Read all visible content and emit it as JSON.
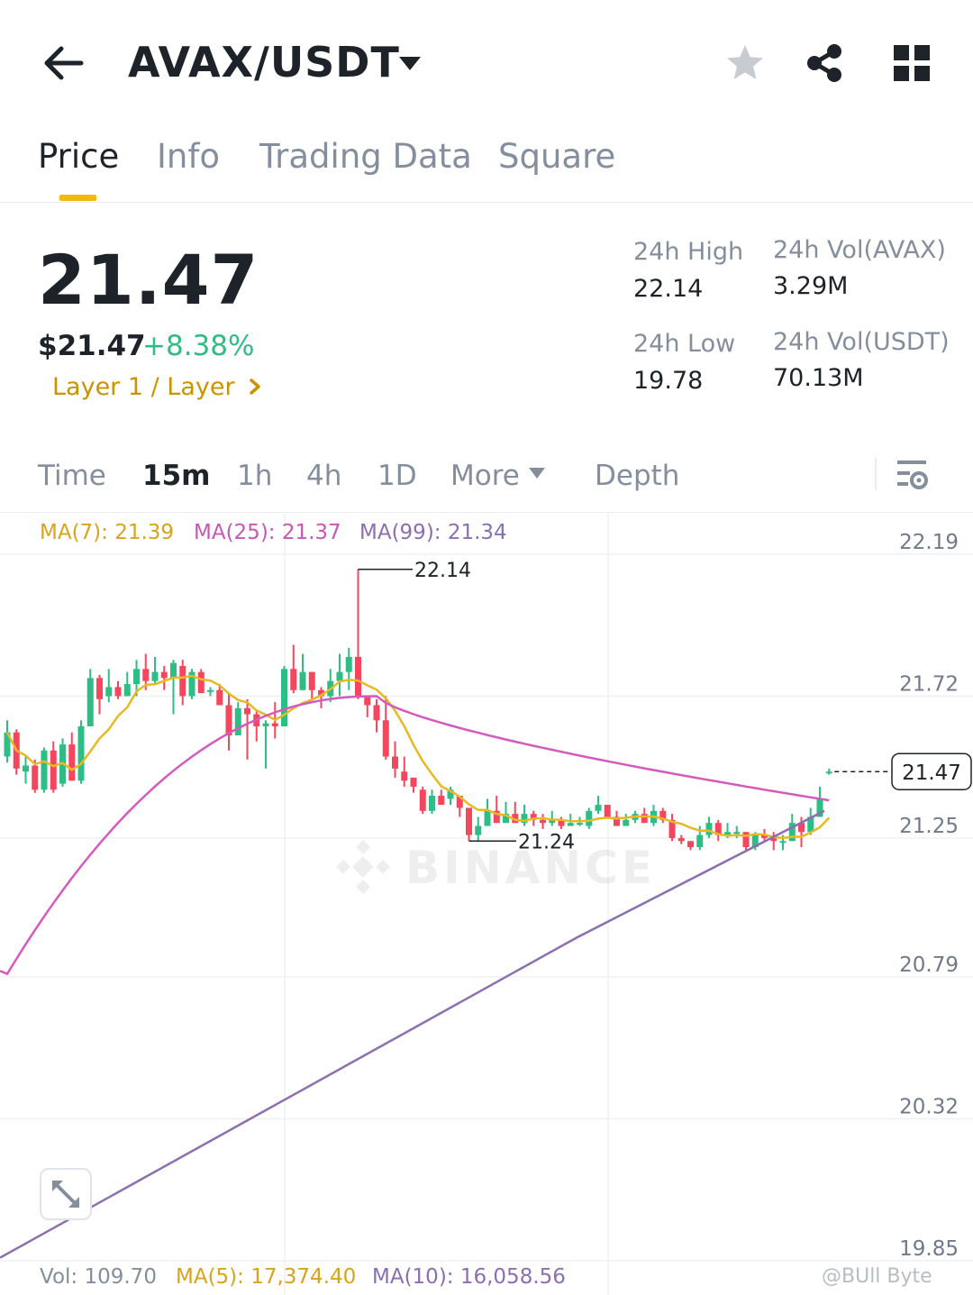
{
  "header": {
    "pair": "AVAX/USDT",
    "icons": [
      "back-arrow-icon",
      "caret-down-icon",
      "star-icon",
      "share-icon",
      "grid-icon"
    ]
  },
  "tabs": [
    {
      "label": "Price",
      "active": true
    },
    {
      "label": "Info",
      "active": false
    },
    {
      "label": "Trading Data",
      "active": false
    },
    {
      "label": "Square",
      "active": false
    }
  ],
  "ticker": {
    "price": "21.47",
    "usd_price": "$21.47",
    "change": "+8.38%",
    "category": "Layer 1 / Layer",
    "stats": [
      {
        "label": "24h High",
        "value": "22.14"
      },
      {
        "label": "24h Vol(AVAX)",
        "value": "3.29M"
      },
      {
        "label": "24h Low",
        "value": "19.78"
      },
      {
        "label": "24h Vol(USDT)",
        "value": "70.13M"
      }
    ]
  },
  "intervals": [
    {
      "label": "Time",
      "active": false
    },
    {
      "label": "15m",
      "active": true
    },
    {
      "label": "1h",
      "active": false
    },
    {
      "label": "4h",
      "active": false
    },
    {
      "label": "1D",
      "active": false
    },
    {
      "label": "More",
      "active": false
    },
    {
      "label": "Depth",
      "active": false
    }
  ],
  "ma_legend": [
    {
      "label": "MA(7): 21.39",
      "color": "#d9a31b"
    },
    {
      "label": "MA(25): 21.37",
      "color": "#c957b5"
    },
    {
      "label": "MA(99): 21.34",
      "color": "#8c6fb0"
    }
  ],
  "vol_legend": [
    {
      "label": "Vol: 109.70",
      "color": "#848e9c"
    },
    {
      "label": "MA(5): 17,374.40",
      "color": "#d9a31b"
    },
    {
      "label": "MA(10): 16,058.56",
      "color": "#8c6fb0"
    }
  ],
  "watermark": "@BUll Byte",
  "colors": {
    "up": "#2ebd85",
    "down": "#f6465d",
    "accent": "#f0b90b",
    "ma7": "#e8b923",
    "ma25": "#d45bbd",
    "ma99": "#8c6fb0"
  },
  "chart_data": {
    "type": "candlestick",
    "y_ticks": [
      "22.19",
      "21.72",
      "21.25",
      "20.79",
      "20.32",
      "19.85"
    ],
    "ylim": [
      19.85,
      22.19
    ],
    "high_label": "22.14",
    "low_label": "21.24",
    "last_price_label": "21.47",
    "watermark_text": "BINANCE",
    "candles": [
      [
        21.52,
        21.6,
        21.64,
        21.5
      ],
      [
        21.6,
        21.48,
        21.61,
        21.46
      ],
      [
        21.47,
        21.49,
        21.52,
        21.43
      ],
      [
        21.49,
        21.41,
        21.51,
        21.4
      ],
      [
        21.41,
        21.54,
        21.55,
        21.4
      ],
      [
        21.54,
        21.41,
        21.57,
        21.4
      ],
      [
        21.43,
        21.56,
        21.58,
        21.42
      ],
      [
        21.56,
        21.44,
        21.6,
        21.44
      ],
      [
        21.44,
        21.62,
        21.64,
        21.43
      ],
      [
        21.62,
        21.78,
        21.81,
        21.62
      ],
      [
        21.78,
        21.71,
        21.79,
        21.66
      ],
      [
        21.72,
        21.75,
        21.81,
        21.7
      ],
      [
        21.75,
        21.72,
        21.77,
        21.71
      ],
      [
        21.72,
        21.76,
        21.8,
        21.72
      ],
      [
        21.76,
        21.81,
        21.84,
        21.72
      ],
      [
        21.81,
        21.77,
        21.86,
        21.74
      ],
      [
        21.77,
        21.8,
        21.85,
        21.76
      ],
      [
        21.8,
        21.78,
        21.82,
        21.74
      ],
      [
        21.78,
        21.83,
        21.84,
        21.66
      ],
      [
        21.82,
        21.72,
        21.84,
        21.69
      ],
      [
        21.72,
        21.8,
        21.81,
        21.71
      ],
      [
        21.8,
        21.73,
        21.81,
        21.73
      ],
      [
        21.74,
        21.74,
        21.75,
        21.72
      ],
      [
        21.74,
        21.69,
        21.76,
        21.69
      ],
      [
        21.69,
        21.59,
        21.73,
        21.54
      ],
      [
        21.59,
        21.68,
        21.7,
        21.59
      ],
      [
        21.68,
        21.66,
        21.71,
        21.51
      ],
      [
        21.66,
        21.62,
        21.67,
        21.57
      ],
      [
        21.62,
        21.63,
        21.64,
        21.48
      ],
      [
        21.63,
        21.62,
        21.7,
        21.58
      ],
      [
        21.62,
        21.81,
        21.82,
        21.62
      ],
      [
        21.81,
        21.74,
        21.89,
        21.73
      ],
      [
        21.74,
        21.8,
        21.86,
        21.74
      ],
      [
        21.8,
        21.74,
        21.8,
        21.71
      ],
      [
        21.74,
        21.72,
        21.75,
        21.68
      ],
      [
        21.72,
        21.77,
        21.81,
        21.7
      ],
      [
        21.77,
        21.8,
        21.86,
        21.72
      ],
      [
        21.8,
        21.85,
        21.88,
        21.74
      ],
      [
        21.85,
        21.72,
        22.14,
        21.71
      ],
      [
        21.72,
        21.69,
        21.7,
        21.65
      ],
      [
        21.69,
        21.64,
        21.71,
        21.6
      ],
      [
        21.64,
        21.52,
        21.72,
        21.51
      ],
      [
        21.52,
        21.48,
        21.57,
        21.45
      ],
      [
        21.47,
        21.44,
        21.52,
        21.42
      ],
      [
        21.45,
        21.42,
        21.45,
        21.4
      ],
      [
        21.41,
        21.34,
        21.42,
        21.33
      ],
      [
        21.34,
        21.39,
        21.41,
        21.33
      ],
      [
        21.39,
        21.36,
        21.41,
        21.36
      ],
      [
        21.38,
        21.41,
        21.42,
        21.36
      ],
      [
        21.39,
        21.35,
        21.39,
        21.32
      ],
      [
        21.35,
        21.26,
        21.35,
        21.24
      ],
      [
        21.26,
        21.29,
        21.32,
        21.24
      ],
      [
        21.29,
        21.34,
        21.38,
        21.29
      ],
      [
        21.34,
        21.3,
        21.39,
        21.3
      ],
      [
        21.3,
        21.33,
        21.37,
        21.3
      ],
      [
        21.33,
        21.3,
        21.37,
        21.3
      ],
      [
        21.3,
        21.33,
        21.36,
        21.29
      ],
      [
        21.33,
        21.31,
        21.34,
        21.29
      ],
      [
        21.31,
        21.3,
        21.33,
        21.28
      ],
      [
        21.3,
        21.31,
        21.34,
        21.29
      ],
      [
        21.31,
        21.29,
        21.32,
        21.28
      ],
      [
        21.29,
        21.3,
        21.33,
        21.29
      ],
      [
        21.3,
        21.3,
        21.32,
        21.29
      ],
      [
        21.29,
        21.34,
        21.35,
        21.28
      ],
      [
        21.34,
        21.36,
        21.39,
        21.33
      ],
      [
        21.36,
        21.32,
        21.36,
        21.32
      ],
      [
        21.32,
        21.29,
        21.34,
        21.29
      ],
      [
        21.29,
        21.31,
        21.33,
        21.29
      ],
      [
        21.31,
        21.33,
        21.34,
        21.3
      ],
      [
        21.33,
        21.3,
        21.35,
        21.3
      ],
      [
        21.3,
        21.34,
        21.36,
        21.29
      ],
      [
        21.34,
        21.31,
        21.35,
        21.3
      ],
      [
        21.31,
        21.25,
        21.33,
        21.24
      ],
      [
        21.25,
        21.24,
        21.26,
        21.23
      ],
      [
        21.24,
        21.22,
        21.24,
        21.21
      ],
      [
        21.22,
        21.26,
        21.29,
        21.21
      ],
      [
        21.26,
        21.3,
        21.32,
        21.25
      ],
      [
        21.3,
        21.26,
        21.31,
        21.24
      ],
      [
        21.26,
        21.27,
        21.3,
        21.25
      ],
      [
        21.27,
        21.27,
        21.29,
        21.25
      ],
      [
        21.27,
        21.22,
        21.27,
        21.21
      ],
      [
        21.22,
        21.26,
        21.27,
        21.21
      ],
      [
        21.26,
        21.25,
        21.28,
        21.24
      ],
      [
        21.25,
        21.24,
        21.27,
        21.21
      ],
      [
        21.24,
        21.24,
        21.26,
        21.21
      ],
      [
        21.24,
        21.3,
        21.33,
        21.24
      ],
      [
        21.3,
        21.27,
        21.32,
        21.22
      ],
      [
        21.27,
        21.32,
        21.35,
        21.26
      ],
      [
        21.32,
        21.38,
        21.42,
        21.32
      ],
      [
        21.47,
        21.47,
        21.48,
        21.46
      ]
    ]
  }
}
